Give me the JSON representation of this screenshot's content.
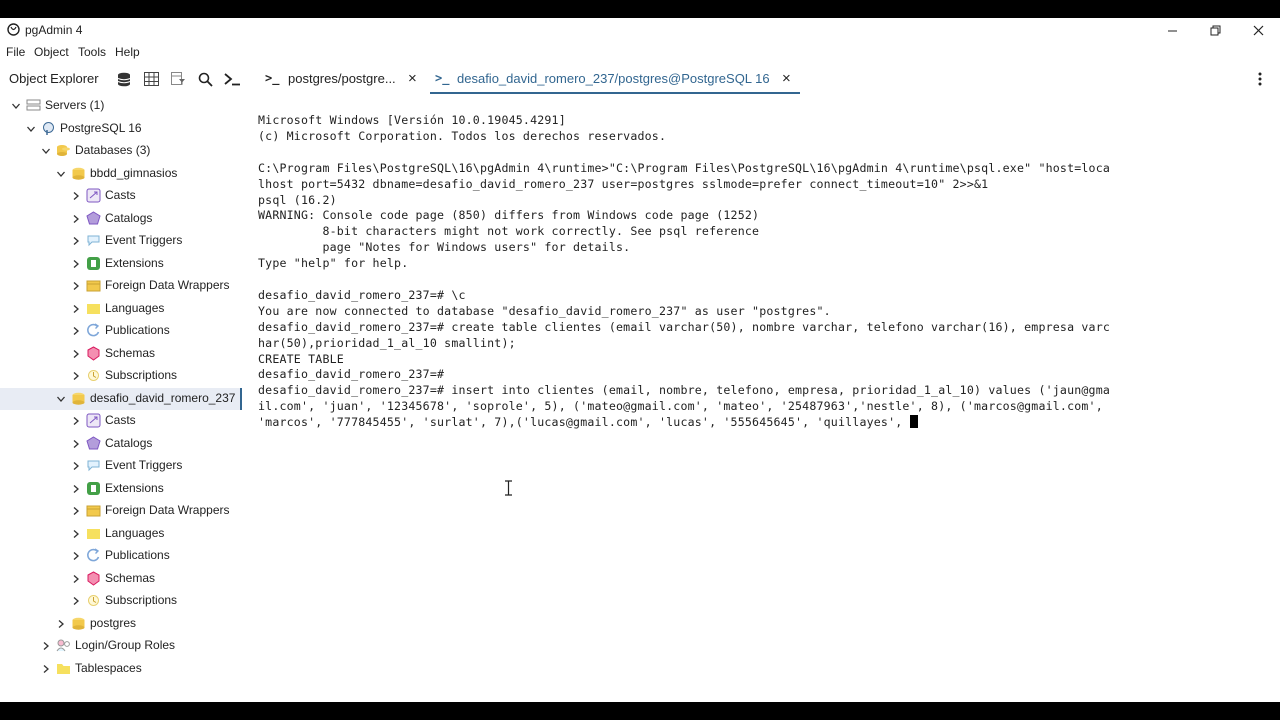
{
  "window": {
    "title": "pgAdmin 4",
    "controls": [
      "minimize",
      "restore",
      "close"
    ]
  },
  "menu": {
    "items": [
      "File",
      "Object",
      "Tools",
      "Help"
    ]
  },
  "object_explorer": {
    "title": "Object Explorer",
    "tools": [
      "database-icon",
      "table-icon",
      "filter-icon",
      "search-icon",
      "terminal-icon"
    ]
  },
  "tree": [
    {
      "label": "Servers (1)",
      "icon": "servers-icon",
      "expanded": true
    },
    {
      "label": "PostgreSQL 16",
      "icon": "elephant-icon",
      "expanded": true
    },
    {
      "label": "Databases (3)",
      "icon": "databases-icon",
      "expanded": true
    },
    {
      "label": "bbdd_gimnasios",
      "icon": "database-icon",
      "expanded": true
    },
    {
      "label": "Casts",
      "icon": "casts-icon"
    },
    {
      "label": "Catalogs",
      "icon": "catalogs-icon"
    },
    {
      "label": "Event Triggers",
      "icon": "event-triggers-icon"
    },
    {
      "label": "Extensions",
      "icon": "extensions-icon"
    },
    {
      "label": "Foreign Data Wrappers",
      "icon": "fdw-icon"
    },
    {
      "label": "Languages",
      "icon": "languages-icon"
    },
    {
      "label": "Publications",
      "icon": "publications-icon"
    },
    {
      "label": "Schemas",
      "icon": "schemas-icon"
    },
    {
      "label": "Subscriptions",
      "icon": "subscriptions-icon"
    },
    {
      "label": "desafio_david_romero_237",
      "icon": "database-icon",
      "expanded": true,
      "selected": true
    },
    {
      "label": "Casts",
      "icon": "casts-icon"
    },
    {
      "label": "Catalogs",
      "icon": "catalogs-icon"
    },
    {
      "label": "Event Triggers",
      "icon": "event-triggers-icon"
    },
    {
      "label": "Extensions",
      "icon": "extensions-icon"
    },
    {
      "label": "Foreign Data Wrappers",
      "icon": "fdw-icon"
    },
    {
      "label": "Languages",
      "icon": "languages-icon"
    },
    {
      "label": "Publications",
      "icon": "publications-icon"
    },
    {
      "label": "Schemas",
      "icon": "schemas-icon"
    },
    {
      "label": "Subscriptions",
      "icon": "subscriptions-icon"
    },
    {
      "label": "postgres",
      "icon": "database-icon"
    },
    {
      "label": "Login/Group Roles",
      "icon": "roles-icon"
    },
    {
      "label": "Tablespaces",
      "icon": "tablespaces-icon"
    }
  ],
  "tabs": [
    {
      "label": "postgres/postgre...",
      "active": false
    },
    {
      "label": "desafio_david_romero_237/postgres@PostgreSQL 16",
      "active": true
    }
  ],
  "terminal": {
    "lines": [
      "Microsoft Windows [Versión 10.0.19045.4291]",
      "(c) Microsoft Corporation. Todos los derechos reservados.",
      "",
      "C:\\Program Files\\PostgreSQL\\16\\pgAdmin 4\\runtime>\"C:\\Program Files\\PostgreSQL\\16\\pgAdmin 4\\runtime\\psql.exe\" \"host=loca",
      "lhost port=5432 dbname=desafio_david_romero_237 user=postgres sslmode=prefer connect_timeout=10\" 2>>&1",
      "psql (16.2)",
      "WARNING: Console code page (850) differs from Windows code page (1252)",
      "         8-bit characters might not work correctly. See psql reference",
      "         page \"Notes for Windows users\" for details.",
      "Type \"help\" for help.",
      "",
      "desafio_david_romero_237=# \\c",
      "You are now connected to database \"desafio_david_romero_237\" as user \"postgres\".",
      "desafio_david_romero_237=# create table clientes (email varchar(50), nombre varchar, telefono varchar(16), empresa varc",
      "har(50),prioridad_1_al_10 smallint);",
      "CREATE TABLE",
      "desafio_david_romero_237=#",
      "desafio_david_romero_237=# insert into clientes (email, nombre, telefono, empresa, prioridad_1_al_10) values ('jaun@gma",
      "il.com', 'juan', '12345678', 'soprole', 5), ('mateo@gmail.com', 'mateo', '25487963','nestle', 8), ('marcos@gmail.com',",
      "'marcos', '777845455', 'surlat', 7),('lucas@gmail.com', 'lucas', '555645645', 'quillayes', "
    ]
  },
  "colors": {
    "accent": "#326690",
    "db_icon": "#f2c94c",
    "selected_bg": "#e8ecf4"
  }
}
